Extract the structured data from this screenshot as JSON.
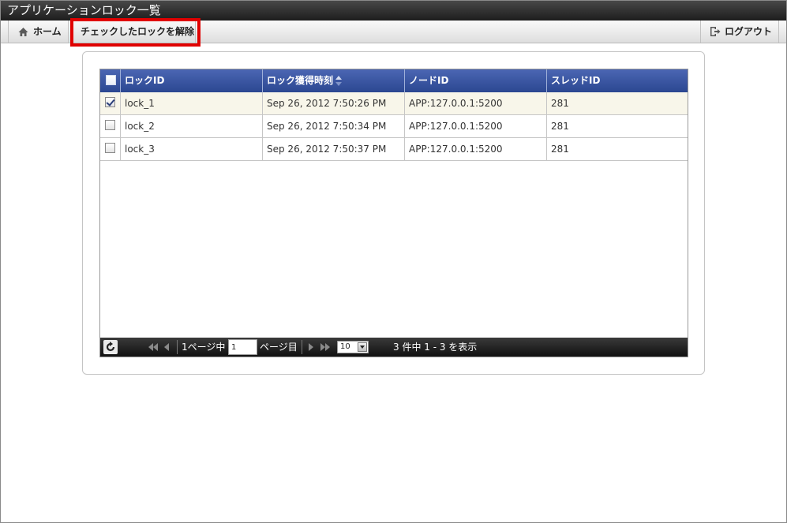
{
  "window": {
    "title": "アプリケーションロック一覧"
  },
  "toolbar": {
    "home_label": "ホーム",
    "release_label": "チェックしたロックを解除",
    "logout_label": "ログアウト"
  },
  "grid": {
    "columns": [
      "ロックID",
      "ロック獲得時刻",
      "ノードID",
      "スレッドID"
    ],
    "sorted_column": "ロック獲得時刻",
    "rows": [
      {
        "checked": true,
        "lock_id": "lock_1",
        "acquired": "Sep 26, 2012 7:50:26 PM",
        "node_id": "APP:127.0.0.1:5200",
        "thread_id": "281"
      },
      {
        "checked": false,
        "lock_id": "lock_2",
        "acquired": "Sep 26, 2012 7:50:34 PM",
        "node_id": "APP:127.0.0.1:5200",
        "thread_id": "281"
      },
      {
        "checked": false,
        "lock_id": "lock_3",
        "acquired": "Sep 26, 2012 7:50:37 PM",
        "node_id": "APP:127.0.0.1:5200",
        "thread_id": "281"
      }
    ]
  },
  "pager": {
    "page_prefix": "1ページ中",
    "current_page": "1",
    "page_suffix": "ページ目",
    "page_size": "10",
    "summary": "3 件中 1 - 3 を表示"
  },
  "colors": {
    "header_blue": "#2b4791",
    "highlight_red": "#e00000",
    "selected_row": "#f8f6ea"
  }
}
